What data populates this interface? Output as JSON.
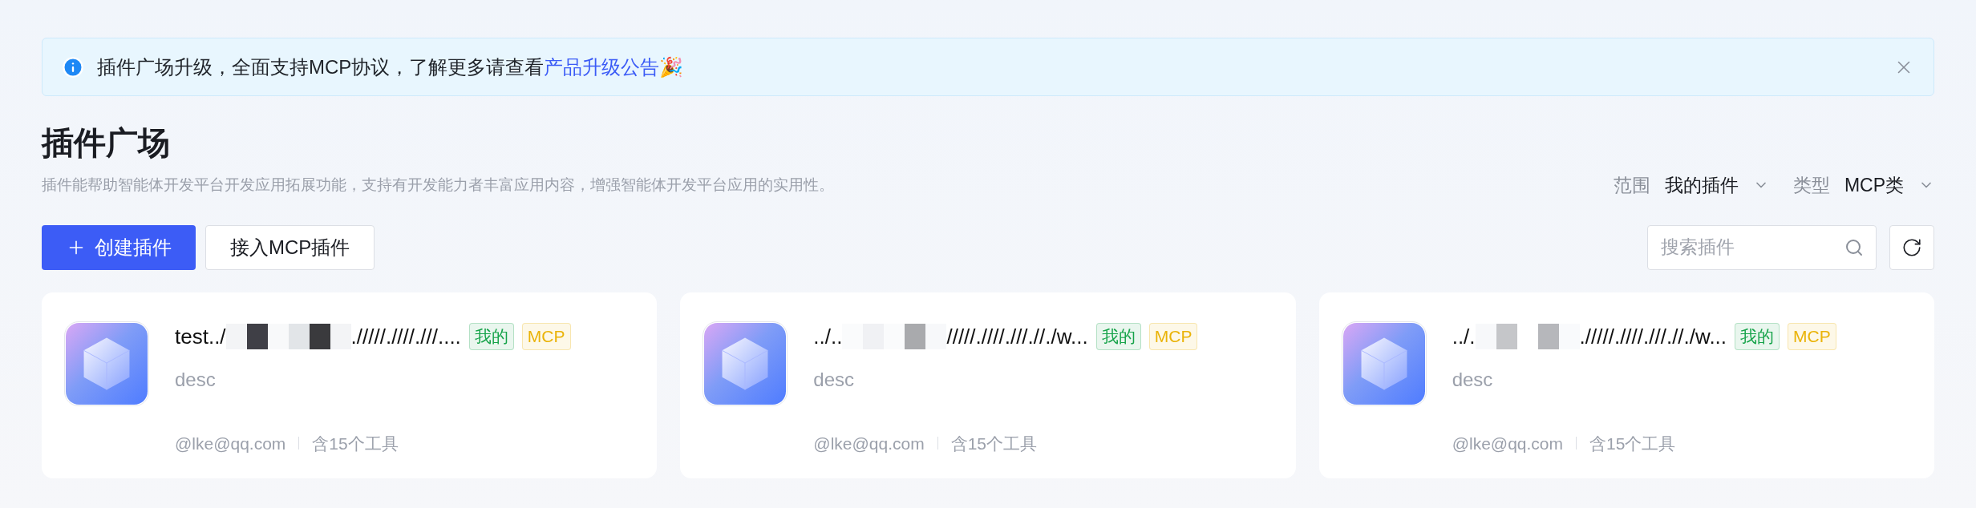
{
  "banner": {
    "text": "插件广场升级，全面支持MCP协议，了解更多请查看",
    "link": "产品升级公告🎉"
  },
  "page": {
    "title": "插件广场",
    "subtitle": "插件能帮助智能体开发平台开发应用拓展功能，支持有开发能力者丰富应用内容，增强智能体开发平台应用的实用性。"
  },
  "filters": [
    {
      "label": "范围",
      "value": "我的插件"
    },
    {
      "label": "类型",
      "value": "MCP类"
    }
  ],
  "actions": [
    {
      "label": "创建插件",
      "kind": "primary"
    },
    {
      "label": "接入MCP插件",
      "kind": "default"
    }
  ],
  "search": {
    "placeholder": "搜索插件"
  },
  "cards": [
    {
      "title_start": "test../",
      "title_end": "./////.////.///....",
      "description": "desc",
      "tags": [
        {
          "label": "我的",
          "color": "#16a34a"
        },
        {
          "label": "MCP",
          "color": "#eab308"
        }
      ],
      "author": "@lke@qq.com",
      "tools": "含15个工具"
    },
    {
      "title_start": "../..",
      "title_end": "/////.////.///.//./w...",
      "description": "desc",
      "tags": [
        {
          "label": "我的",
          "color": "#16a34a"
        },
        {
          "label": "MCP",
          "color": "#eab308"
        }
      ],
      "author": "@lke@qq.com",
      "tools": "含15个工具"
    },
    {
      "title_start": "../.",
      "title_end": "./////.////.///.//./w...",
      "description": "desc",
      "tags": [
        {
          "label": "我的",
          "color": "#16a34a"
        },
        {
          "label": "MCP",
          "color": "#eab308"
        }
      ],
      "author": "@lke@qq.com",
      "tools": "含15个工具"
    }
  ]
}
